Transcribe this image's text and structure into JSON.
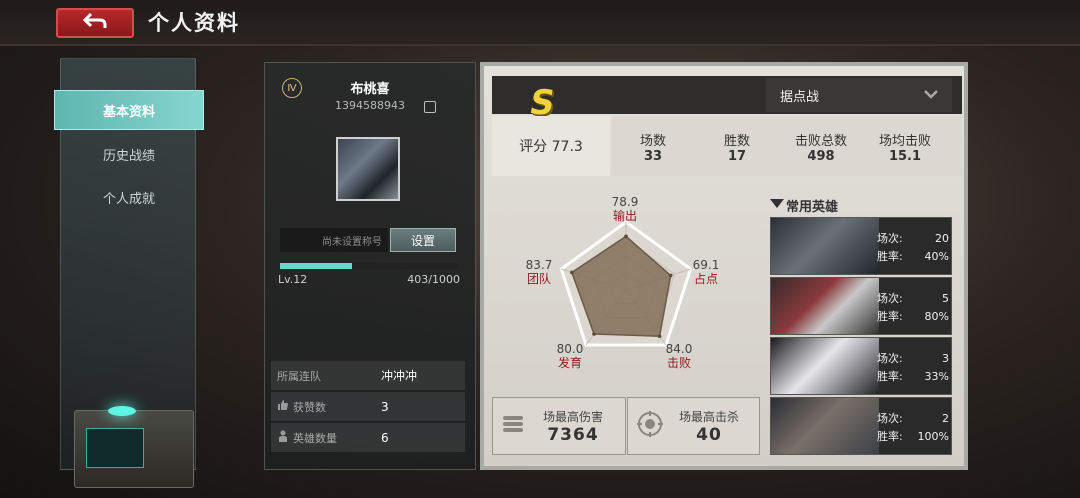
{
  "header": {
    "title": "个人资料",
    "back_icon": "return-arrow-icon"
  },
  "nav": {
    "items": [
      {
        "label": "基本资料",
        "active": true
      },
      {
        "label": "历史战绩",
        "active": false
      },
      {
        "label": "个人成就",
        "active": false
      }
    ]
  },
  "profile": {
    "rank_badge": "Ⅳ",
    "name": "布桃喜",
    "id": "1394588943",
    "title_placeholder": "尚未设置称号",
    "set_label": "设置",
    "level": "Lv.12",
    "xp": "403/1000",
    "xp_progress": 0.403,
    "team_label": "所属连队",
    "team_value": "冲冲冲",
    "likes_label": "获赞数",
    "likes_value": "3",
    "heroes_label": "英雄数量",
    "heroes_value": "6"
  },
  "stats": {
    "grade": "S",
    "mode": "据点战",
    "score": "评分 77.3",
    "columns": [
      {
        "label": "场数",
        "value": "33"
      },
      {
        "label": "胜数",
        "value": "17"
      },
      {
        "label": "击败总数",
        "value": "498"
      },
      {
        "label": "场均击败",
        "value": "15.1"
      }
    ],
    "best_damage_label": "场最高伤害",
    "best_damage_value": "7364",
    "best_kills_label": "场最高击杀",
    "best_kills_value": "40"
  },
  "chart_data": {
    "type": "radar",
    "axes": [
      "输出",
      "占点",
      "击败",
      "发育",
      "团队"
    ],
    "values": [
      78.9,
      69.1,
      84.0,
      80.0,
      83.7
    ],
    "labels": [
      "78.9",
      "69.1",
      "84.0",
      "80.0",
      "83.7"
    ],
    "range": [
      0,
      100
    ]
  },
  "heroes": {
    "title": "常用英雄",
    "matches_label": "场次:",
    "winrate_label": "胜率:",
    "list": [
      {
        "matches": "20",
        "winrate": "40%",
        "color": "#5a6068"
      },
      {
        "matches": "5",
        "winrate": "80%",
        "color": "#6a2e30"
      },
      {
        "matches": "3",
        "winrate": "33%",
        "color": "#c8c8cc"
      },
      {
        "matches": "2",
        "winrate": "100%",
        "color": "#4a5058"
      }
    ]
  }
}
